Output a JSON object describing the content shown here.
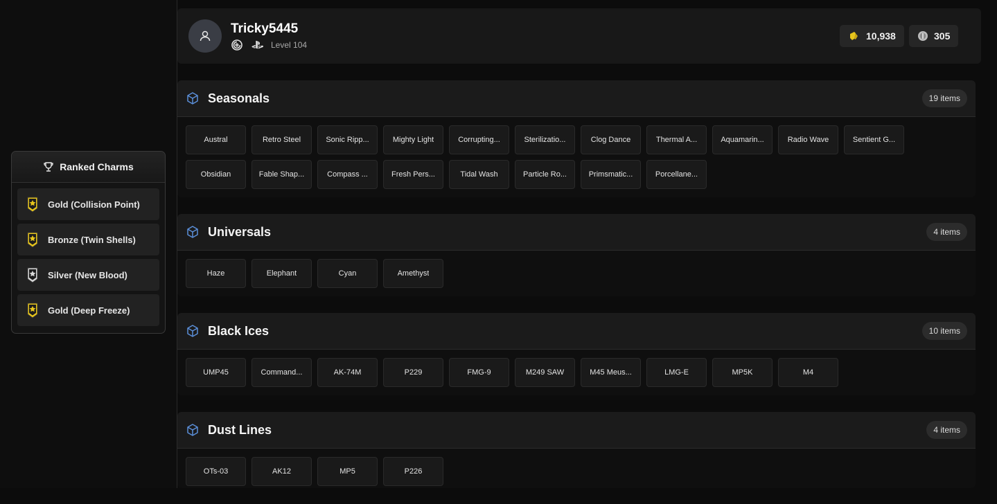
{
  "sidebar": {
    "ranked_title": "Ranked Charms",
    "ranked_items": [
      {
        "label": "Gold (Collision Point)",
        "tier": "gold"
      },
      {
        "label": "Bronze (Twin Shells)",
        "tier": "gold"
      },
      {
        "label": "Silver (New Blood)",
        "tier": "silver"
      },
      {
        "label": "Gold (Deep Freeze)",
        "tier": "gold"
      }
    ]
  },
  "profile": {
    "username": "Tricky5445",
    "level": "Level 104",
    "platform_icons": [
      "ubisoft-icon",
      "playstation-icon"
    ],
    "credits": "10,938",
    "renown": "305"
  },
  "colors": {
    "accent_icon": "#5b8fd9",
    "gold": "#e7c51c"
  },
  "sections": [
    {
      "title": "Seasonals",
      "count": "19 items",
      "items": [
        "Austral",
        "Retro Steel",
        "Sonic Ripp...",
        "Mighty Light",
        "Corrupting...",
        "Sterilizatio...",
        "Clog Dance",
        "Thermal A...",
        "Aquamarin...",
        "Radio Wave",
        "Sentient G...",
        "Obsidian",
        "Fable Shap...",
        "Compass ...",
        "Fresh Pers...",
        "Tidal Wash",
        "Particle Ro...",
        "Primsmatic...",
        "Porcellane..."
      ]
    },
    {
      "title": "Universals",
      "count": "4 items",
      "items": [
        "Haze",
        "Elephant",
        "Cyan",
        "Amethyst"
      ]
    },
    {
      "title": "Black Ices",
      "count": "10 items",
      "items": [
        "UMP45",
        "Command...",
        "AK-74M",
        "P229",
        "FMG-9",
        "M249 SAW",
        "M45 Meus...",
        "LMG-E",
        "MP5K",
        "M4"
      ]
    },
    {
      "title": "Dust Lines",
      "count": "4 items",
      "items": [
        "OTs-03",
        "AK12",
        "MP5",
        "P226"
      ]
    }
  ]
}
